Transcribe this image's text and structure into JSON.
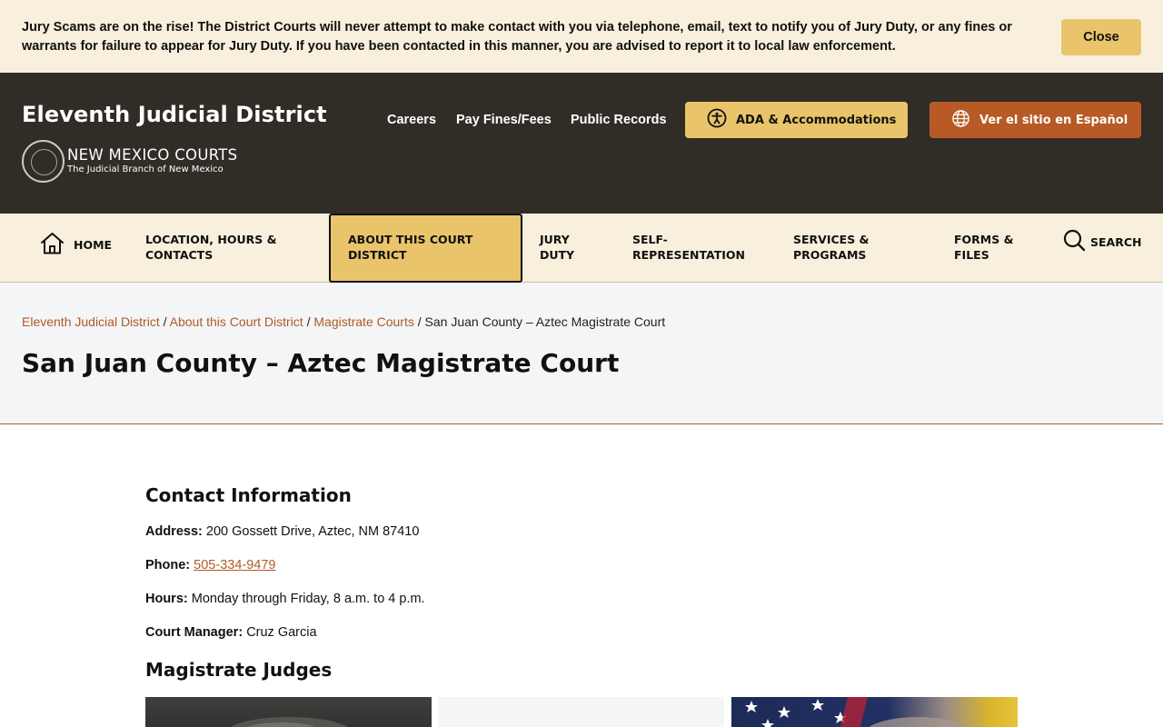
{
  "alert": {
    "message": "Jury Scams are on the rise! The District Courts will never attempt to make contact with you via telephone, email, text to notify you of Jury Duty, or any fines or warrants for failure to appear for Jury Duty. If you have been contacted in this manner, you are advised to report it to local law enforcement.",
    "close_label": "Close"
  },
  "header": {
    "site_title": "Eleventh Judicial District",
    "logo_name": "NEW MEXICO COURTS",
    "logo_tagline": "The Judicial Branch of New Mexico",
    "utility_links": [
      "Careers",
      "Pay Fines/Fees",
      "Public Records"
    ],
    "ada_label": "ADA & Accommodations",
    "ada_icon": "accessibility-icon",
    "spanish_label": "Ver el sitio en Español",
    "spanish_icon": "globe-icon",
    "colors": {
      "background": "#322c27",
      "ada": "#e9c46a",
      "spanish": "#b75a25"
    }
  },
  "nav": {
    "home": "HOME",
    "items": [
      "LOCATION, HOURS & CONTACTS",
      "ABOUT THIS COURT DISTRICT",
      "JURY DUTY",
      "SELF-REPRESENTATION",
      "SERVICES & PROGRAMS",
      "FORMS & FILES"
    ],
    "active": "ABOUT THIS COURT DISTRICT",
    "search": "SEARCH"
  },
  "breadcrumb": {
    "links": [
      "Eleventh Judicial District",
      "About this Court District",
      "Magistrate Courts"
    ],
    "separator": "/",
    "current": "San Juan County – Aztec Magistrate Court"
  },
  "page": {
    "title": "San Juan County – Aztec Magistrate Court"
  },
  "contact": {
    "heading": "Contact Information",
    "address_label": "Address:",
    "address": "200 Gossett Drive, Aztec, NM 87410",
    "phone_label": "Phone:",
    "phone": "505-334-9479",
    "hours_label": "Hours:",
    "hours": "Monday through Friday, 8 a.m. to 4 p.m.",
    "manager_label": "Court Manager:",
    "manager": "Cruz Garcia"
  },
  "judges": {
    "heading": "Magistrate Judges"
  }
}
